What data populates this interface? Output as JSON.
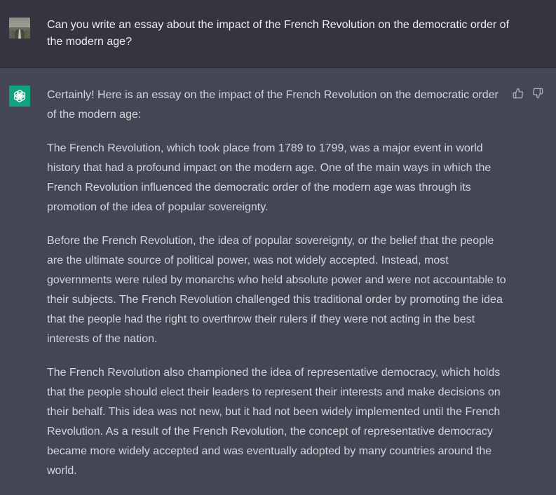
{
  "user_message": {
    "text": "Can you write an essay about the impact of the French Revolution on the democratic order of the modern age?"
  },
  "assistant_message": {
    "paragraphs": [
      "Certainly! Here is an essay on the impact of the French Revolution on the democratic order of the modern age:",
      "The French Revolution, which took place from 1789 to 1799, was a major event in world history that had a profound impact on the modern age. One of the main ways in which the French Revolution influenced the democratic order of the modern age was through its promotion of the idea of popular sovereignty.",
      "Before the French Revolution, the idea of popular sovereignty, or the belief that the people are the ultimate source of political power, was not widely accepted. Instead, most governments were ruled by monarchs who held absolute power and were not accountable to their subjects. The French Revolution challenged this traditional order by promoting the idea that the people had the right to overthrow their rulers if they were not acting in the best interests of the nation.",
      "The French Revolution also championed the idea of representative democracy, which holds that the people should elect their leaders to represent their interests and make decisions on their behalf. This idea was not new, but it had not been widely implemented until the French Revolution. As a result of the French Revolution, the concept of representative democracy became more widely accepted and was eventually adopted by many countries around the world."
    ],
    "feedback": {
      "up_icon": "thumbs-up-icon",
      "down_icon": "thumbs-down-icon"
    }
  },
  "colors": {
    "user_bg": "#343541",
    "assistant_bg": "#444654",
    "brand": "#10a37f"
  }
}
